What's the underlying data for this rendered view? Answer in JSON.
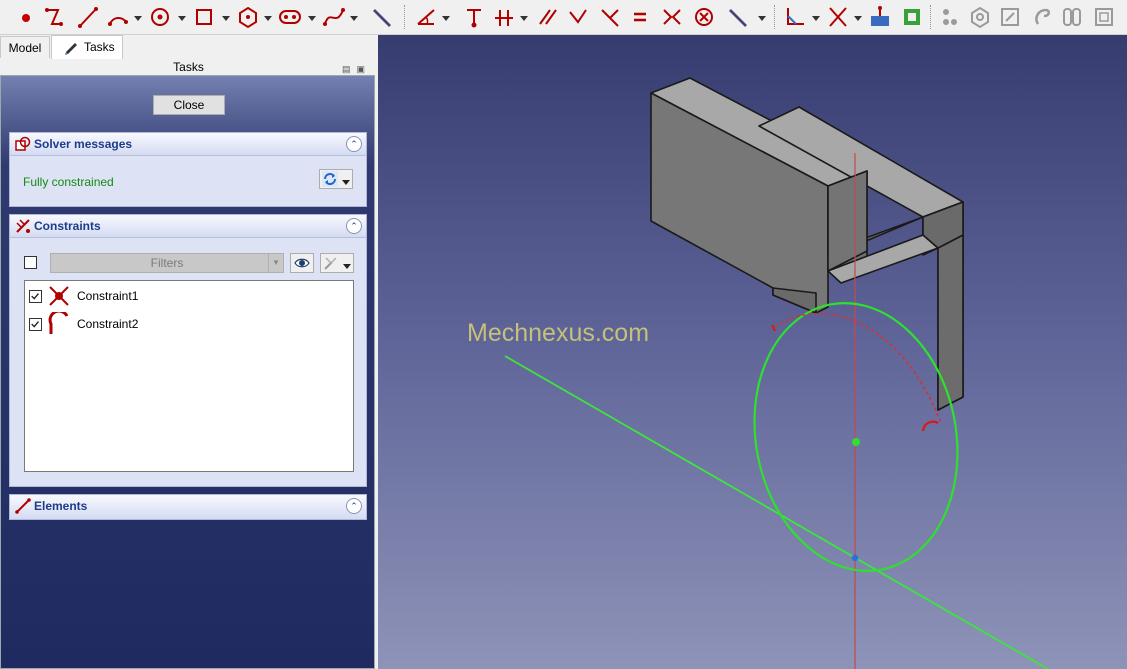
{
  "tabs": [
    {
      "label": "Model"
    },
    {
      "label": "Tasks"
    }
  ],
  "panel_title": "Tasks",
  "close_button": "Close",
  "solver": {
    "title": "Solver messages",
    "status": "Fully constrained"
  },
  "constraints": {
    "title": "Constraints",
    "filter_label": "Filters",
    "items": [
      {
        "name": "Constraint1",
        "icon": "point-on-object-icon",
        "checked": true
      },
      {
        "name": "Constraint2",
        "icon": "tangent-icon",
        "checked": true
      }
    ]
  },
  "elements": {
    "title": "Elements"
  },
  "viewport": {
    "watermark": "Mechnexus.com"
  },
  "colors": {
    "accent_red": "#b00000",
    "status_green": "#138a13",
    "sketch_green": "#3ee43e",
    "axis_red": "#c84848",
    "header_blue": "#1d3c8a"
  },
  "toolbar_icons": [
    "point-icon",
    "polyline-icon",
    "line-icon",
    "arc-icon",
    "circle-icon",
    "rectangle-icon",
    "polygon-icon",
    "slot-icon",
    "bspline-icon",
    "external-geometry-icon",
    "fillet-icon",
    "constrain-coincident-icon",
    "constrain-point-on-object-icon",
    "constrain-parallel-icon",
    "constrain-perpendicular-icon",
    "constrain-tangent-icon",
    "constrain-equal-icon",
    "constrain-symmetric-icon",
    "constrain-block-icon",
    "constrain-distance-icon",
    "toggle-construction-icon",
    "trim-icon",
    "extend-icon",
    "carbon-copy-icon",
    "select-conflicts-icon",
    "select-redundant-icon",
    "clone-icon",
    "copy-icon",
    "move-icon",
    "rectangular-array-icon"
  ]
}
